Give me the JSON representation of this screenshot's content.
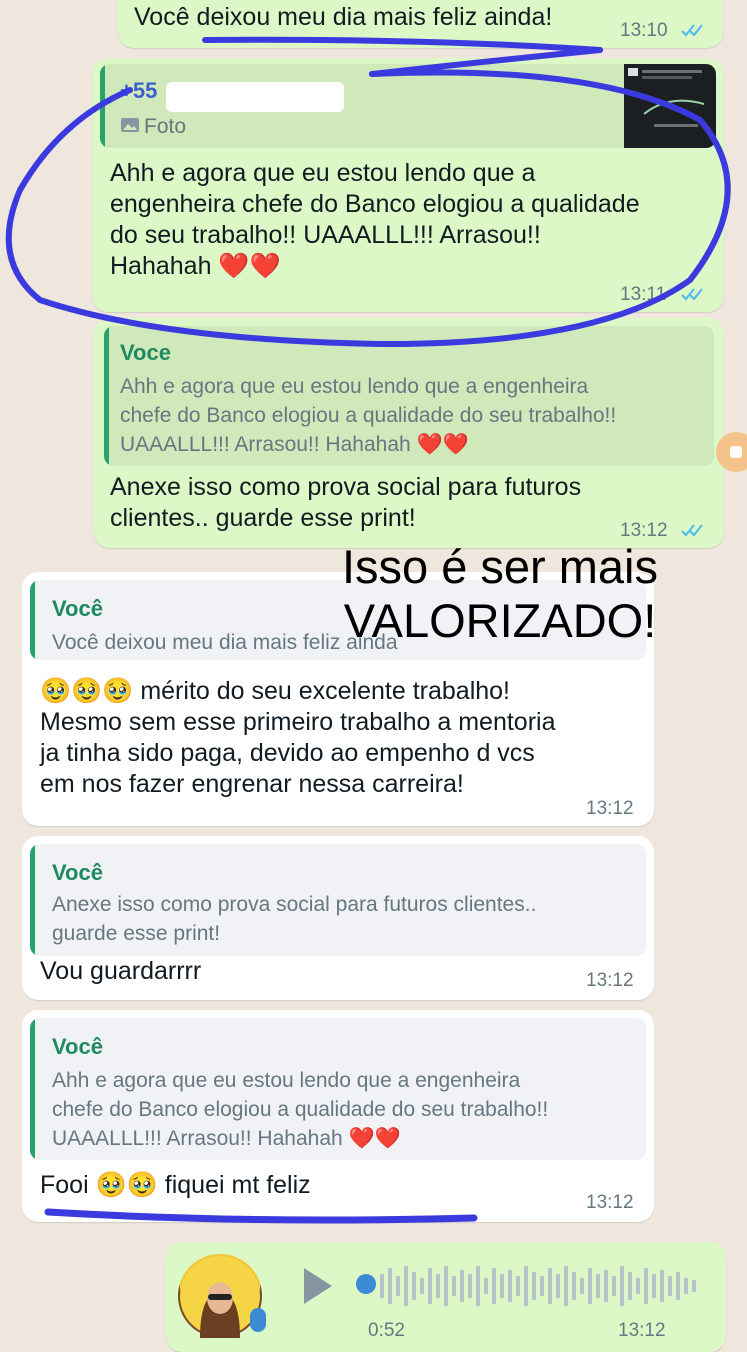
{
  "messages": {
    "m1": {
      "text": "Você deixou meu dia mais feliz ainda!",
      "time": "13:10"
    },
    "m2": {
      "quote_author": "+55",
      "quote_sub": "Foto",
      "text": "Ahh e agora que eu estou lendo que a\nengenheira chefe do Banco elogiou a qualidade\ndo seu trabalho!! UAAALLL!!! Arrasou!!\nHahahah ❤️❤️",
      "time": "13:11"
    },
    "m3": {
      "quote_author": "Voce",
      "quote_text": "Ahh e agora que eu estou lendo que a engenheira\nchefe do Banco elogiou a qualidade do seu trabalho!!\nUAAALLL!!! Arrasou!! Hahahah ❤️❤️",
      "text": "Anexe isso como prova social para futuros\nclientes.. guarde esse print!",
      "time": "13:12"
    },
    "m4": {
      "quote_author": "Você",
      "quote_text": "Você deixou meu dia mais feliz ainda",
      "text": "🥹🥹🥹 mérito do seu excelente trabalho!\nMesmo sem esse primeiro trabalho a mentoria\nja tinha sido paga, devido ao empenho d vcs\nem nos fazer engrenar nessa carreira!",
      "time": "13:12"
    },
    "m5": {
      "quote_author": "Você",
      "quote_text": "Anexe isso como prova social para futuros clientes..\nguarde esse print!",
      "text": "Vou guardarrrr",
      "time": "13:12"
    },
    "m6": {
      "quote_author": "Você",
      "quote_text": "Ahh e agora que eu estou lendo que a engenheira\nchefe do Banco elogiou a qualidade do seu trabalho!!\nUAAALLL!!! Arrasou!! Hahahah ❤️❤️",
      "text": "Fooi 🥹🥹 fiquei mt feliz",
      "time": "13:12"
    },
    "voice": {
      "duration": "0:52",
      "time": "13:12"
    }
  },
  "overlay": {
    "line1": "Isso é ser mais",
    "line2": "VALORIZADO!"
  },
  "colors": {
    "outgoing": "#dcf8c6",
    "incoming": "#ffffff",
    "accent": "#25a36b",
    "annotation": "#3a3adf",
    "ticks": "#53bdeb"
  }
}
